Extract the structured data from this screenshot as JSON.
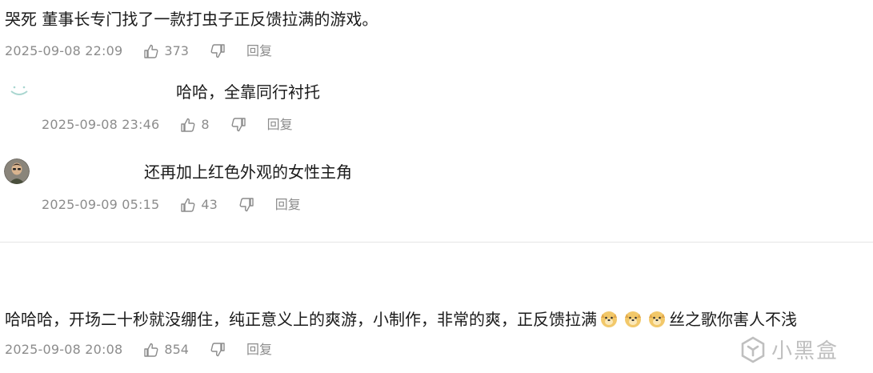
{
  "comments": [
    {
      "text": "哭死 董事长专门找了一款打虫子正反馈拉满的游戏。",
      "time": "2025-09-08 22:09",
      "likes": "373",
      "reply_label": "回复"
    },
    {
      "text": "哈哈，全靠同行衬托",
      "time": "2025-09-08 23:46",
      "likes": "8",
      "reply_label": "回复"
    },
    {
      "text": "还再加上红色外观的女性主角",
      "time": "2025-09-09 05:15",
      "likes": "43",
      "reply_label": "回复"
    },
    {
      "text_before": "哈哈哈，开场二十秒就没绷住，纯正意义上的爽游，小制作，非常的爽，正反馈拉满",
      "text_after": "丝之歌你害人不浅",
      "time": "2025-09-08 20:08",
      "likes": "854",
      "reply_label": "回复"
    }
  ],
  "watermark": {
    "text": "小黑盒"
  },
  "icons": {
    "like": "thumbs-up-icon",
    "dislike": "thumbs-down-icon",
    "emoji": "doge-emoji-icon"
  }
}
